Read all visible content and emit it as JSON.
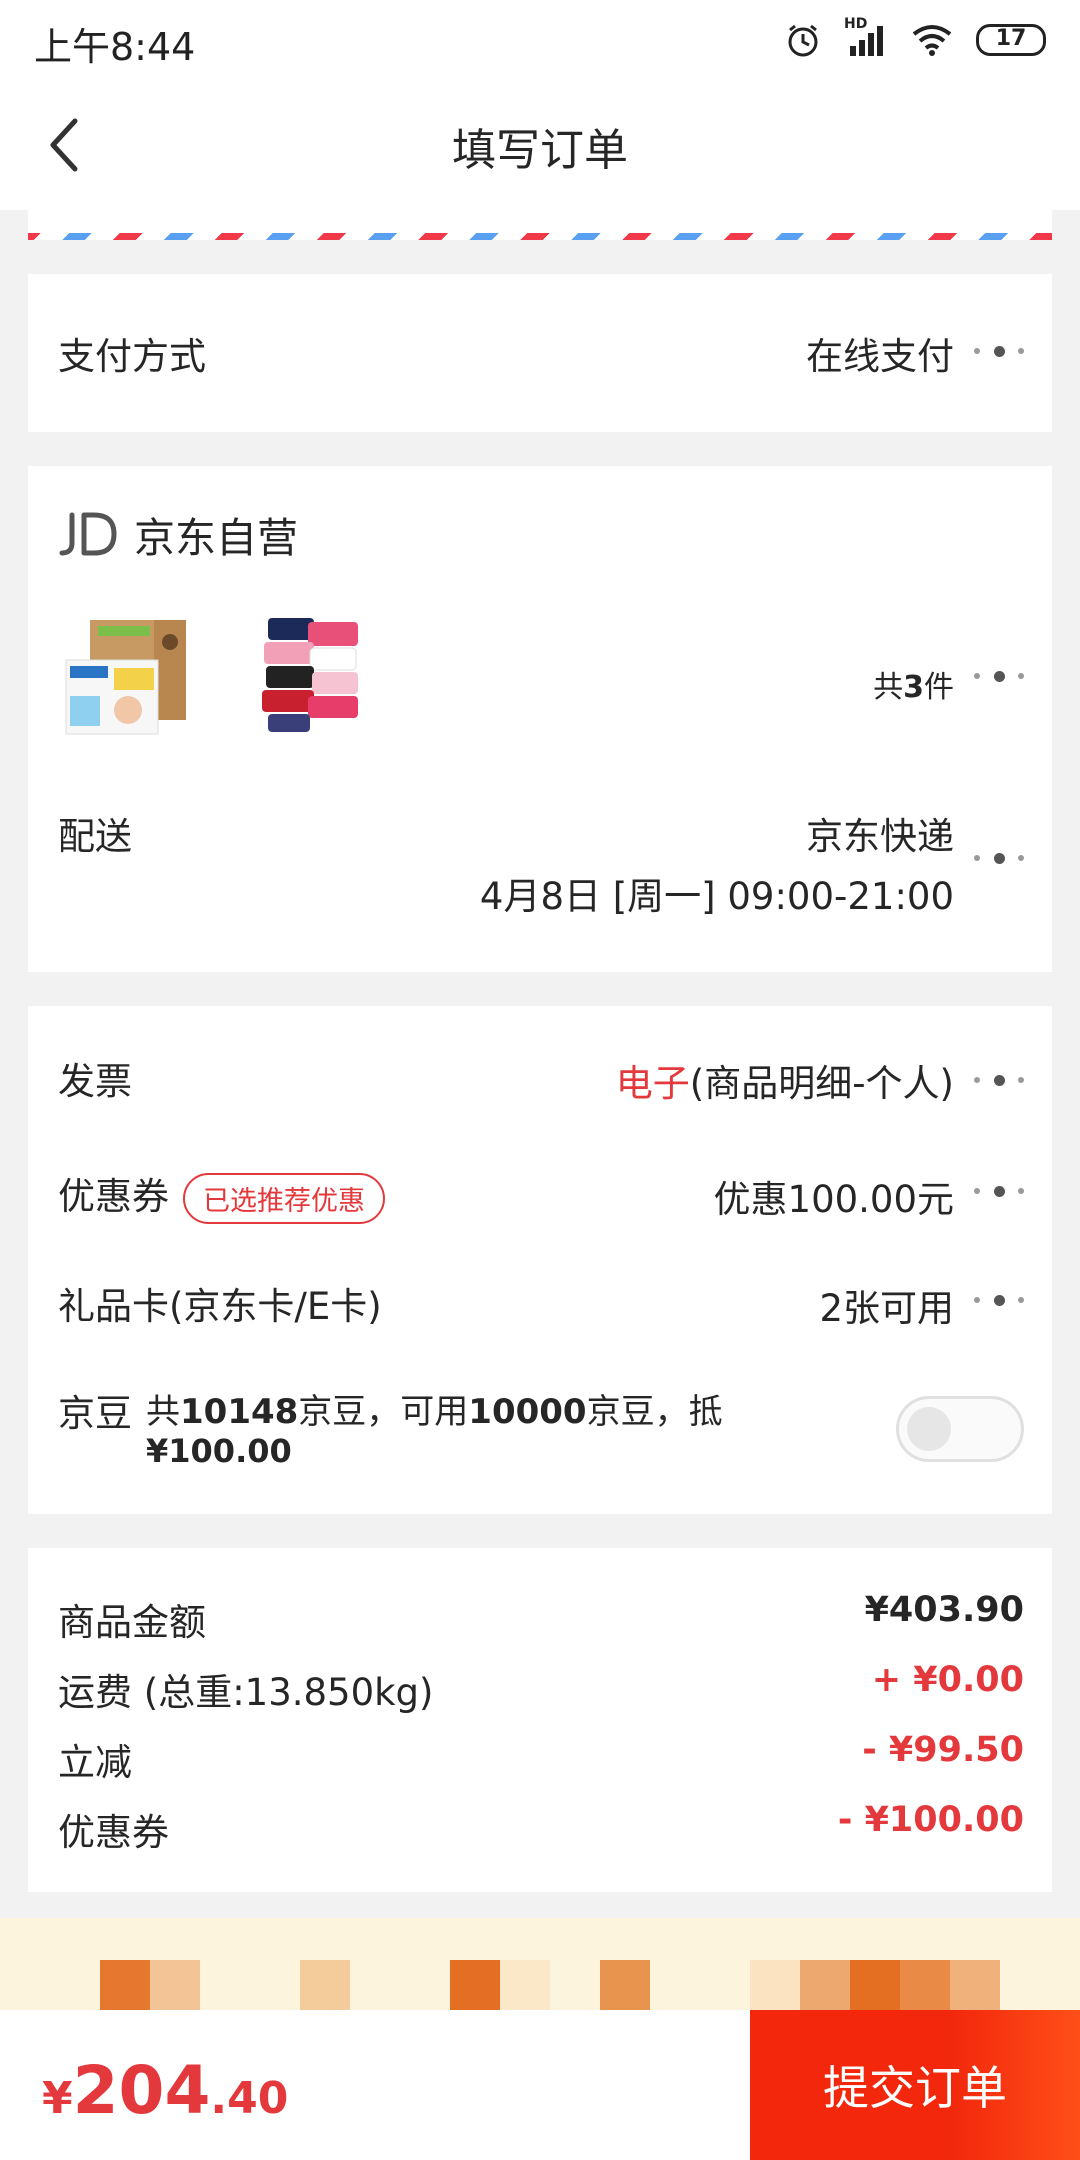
{
  "status_bar": {
    "time": "上午8:44",
    "battery": "17",
    "network": "HD"
  },
  "nav": {
    "title": "填写订单"
  },
  "payment": {
    "label": "支付方式",
    "value": "在线支付"
  },
  "shop": {
    "name": "京东自营",
    "item_count_prefix": "共",
    "item_count": "3",
    "item_count_suffix": "件",
    "delivery_label": "配送",
    "delivery_carrier": "京东快递",
    "delivery_time": "4月8日 [周一] 09:00-21:00"
  },
  "invoice": {
    "label": "发票",
    "type": "电子",
    "detail": "(商品明细-个人)"
  },
  "coupon": {
    "label": "优惠券",
    "tag": "已选推荐优惠",
    "value": "优惠100.00元"
  },
  "giftcard": {
    "label": "礼品卡(京东卡/E卡)",
    "value": "2张可用"
  },
  "jingdou": {
    "label": "京豆",
    "t1": "共",
    "total": "10148",
    "t2": "京豆，可用",
    "usable": "10000",
    "t3": "京豆，抵",
    "deduct": "¥100.00",
    "enabled": false
  },
  "summary": [
    {
      "label": "商品金额",
      "value": "¥403.90",
      "color": "#262626"
    },
    {
      "label": "运费 (总重:13.850kg)",
      "value": "+ ¥0.00",
      "color": "#e4393c"
    },
    {
      "label": "立减",
      "value": "- ¥99.50",
      "color": "#e4393c"
    },
    {
      "label": "优惠券",
      "value": "- ¥100.00",
      "color": "#e4393c"
    }
  ],
  "footer": {
    "currency": "¥",
    "total_int": "204",
    "total_dec": ".40",
    "submit_label": "提交订单"
  },
  "colors": {
    "accent": "#e4393c",
    "submit": "#f2270c",
    "banner": "#fdf4dd"
  }
}
